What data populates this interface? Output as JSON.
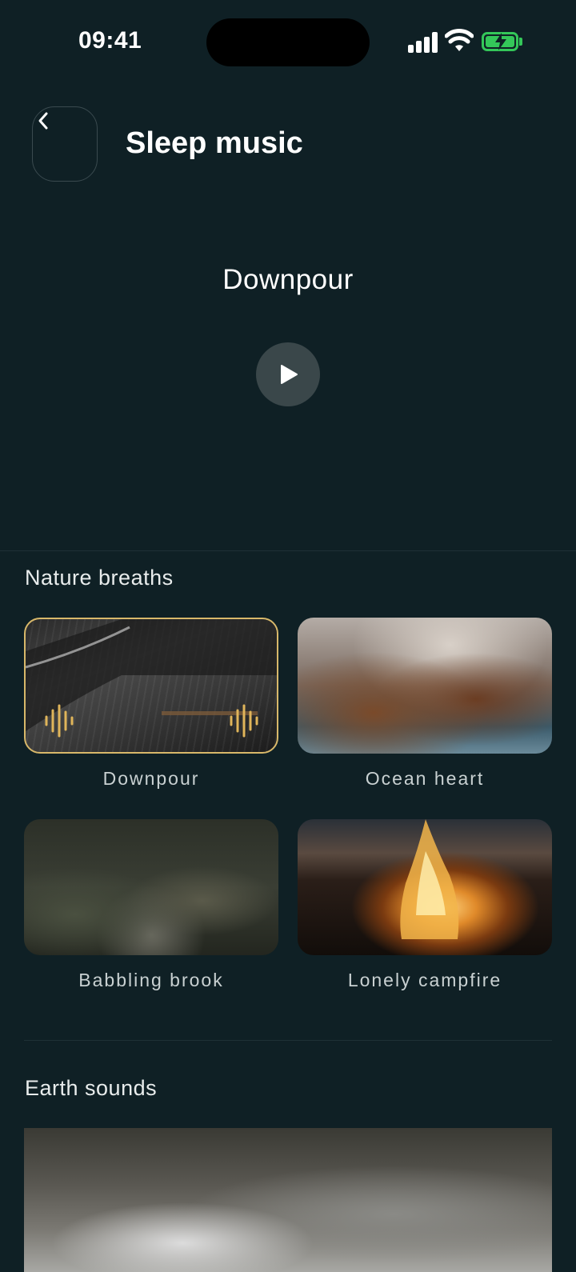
{
  "status_bar": {
    "time": "09:41"
  },
  "header": {
    "title": "Sleep music"
  },
  "player": {
    "now_playing": "Downpour"
  },
  "sections": [
    {
      "label": "Nature breaths",
      "items": [
        {
          "label": "Downpour",
          "selected": true
        },
        {
          "label": "Ocean heart",
          "selected": false
        },
        {
          "label": "Babbling brook",
          "selected": false
        },
        {
          "label": "Lonely campfire",
          "selected": false
        }
      ]
    },
    {
      "label": "Earth sounds",
      "items": []
    }
  ],
  "colors": {
    "background": "#0f2025",
    "accent_gold": "#d8b86a",
    "battery_green": "#34c759",
    "play_button": "#3a474a"
  },
  "icons": {
    "back": "chevron-left-icon",
    "play": "play-icon",
    "playing": "sound-wave-icon"
  }
}
